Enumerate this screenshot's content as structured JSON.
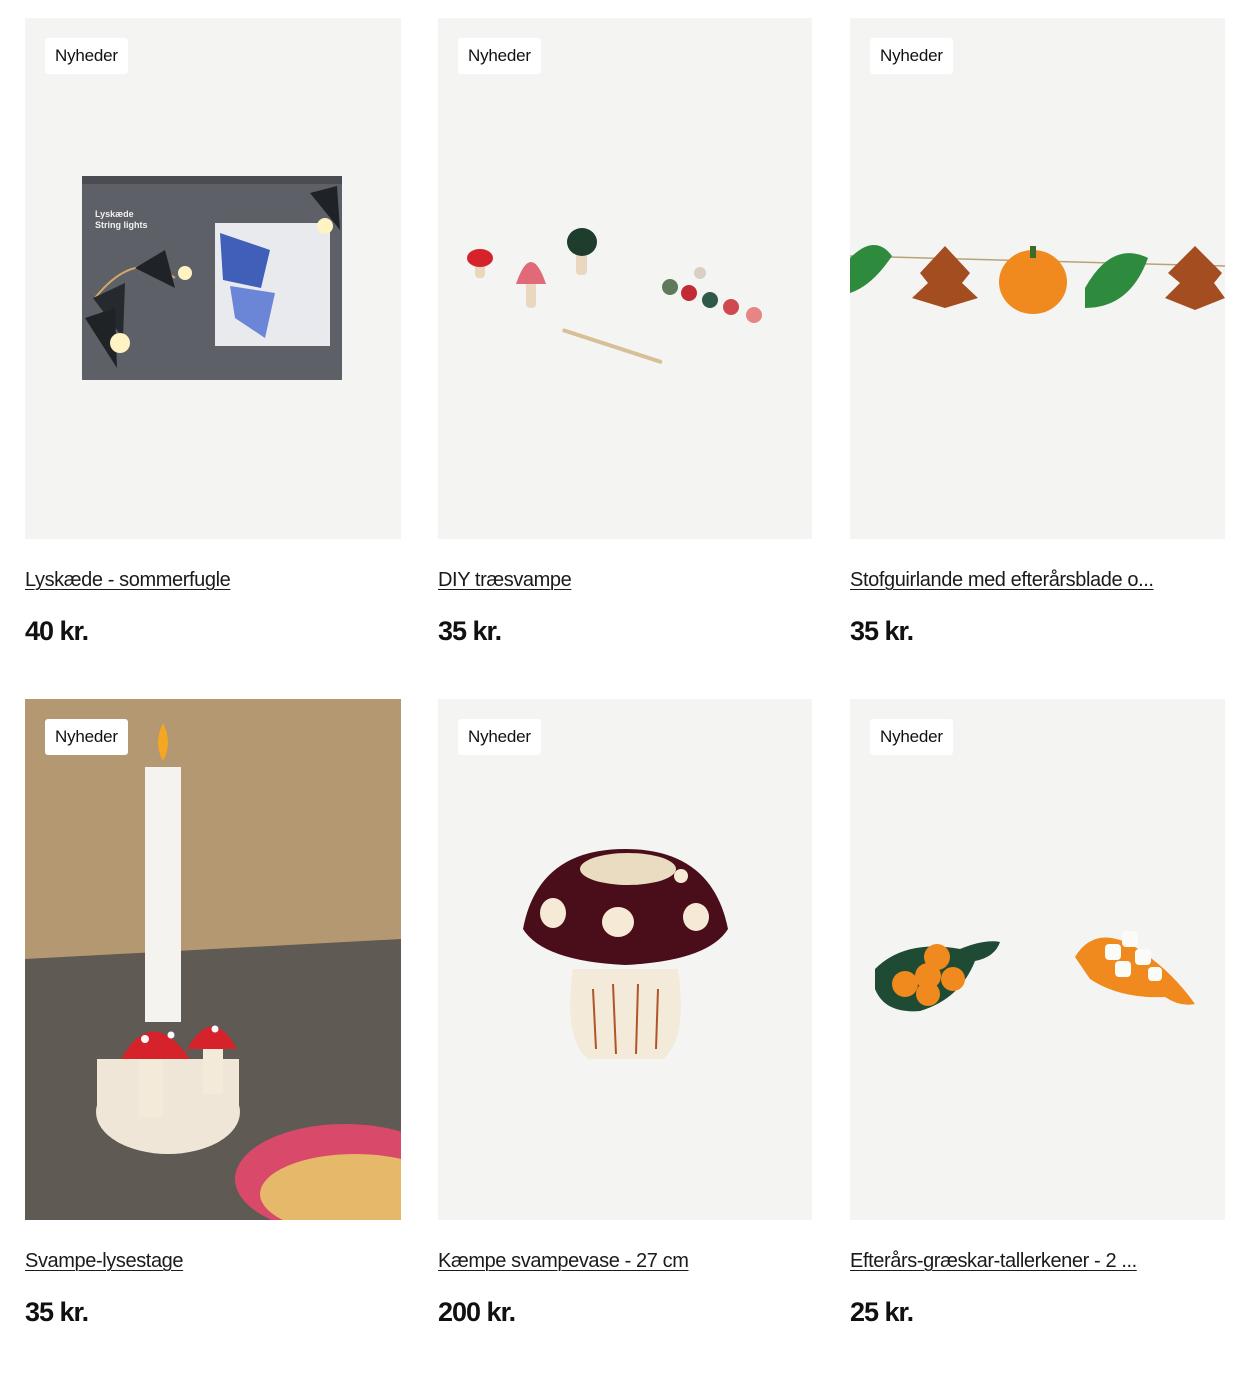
{
  "products": [
    {
      "badge": "Nyheder",
      "name": "Lyskæde - sommerfugle",
      "price": "40 kr.",
      "image": "butterfly-string-lights-box",
      "box_text_1": "Lyskæde",
      "box_text_2": "String lights"
    },
    {
      "badge": "Nyheder",
      "name": "DIY træsvampe",
      "price": "35 kr.",
      "image": "diy-wooden-mushrooms-paint-kit"
    },
    {
      "badge": "Nyheder",
      "name": "Stofguirlande med efterårsblade o...",
      "price": "35 kr.",
      "image": "felt-autumn-leaf-pumpkin-garland"
    },
    {
      "badge": "Nyheder",
      "name": "Svampe-lysestage",
      "price": "35 kr.",
      "image": "mushroom-candle-holder-lifestyle"
    },
    {
      "badge": "Nyheder",
      "name": "Kæmpe svampevase - 27 cm",
      "price": "200 kr.",
      "image": "giant-mushroom-vase"
    },
    {
      "badge": "Nyheder",
      "name": "Efterårs-græskar-tallerkener - 2 ...",
      "price": "25 kr.",
      "image": "autumn-pumpkin-leaf-plates"
    }
  ],
  "colors": {
    "card_background": "#f4f4f3",
    "badge_background": "#ffffff",
    "text": "#1a1a1a"
  }
}
